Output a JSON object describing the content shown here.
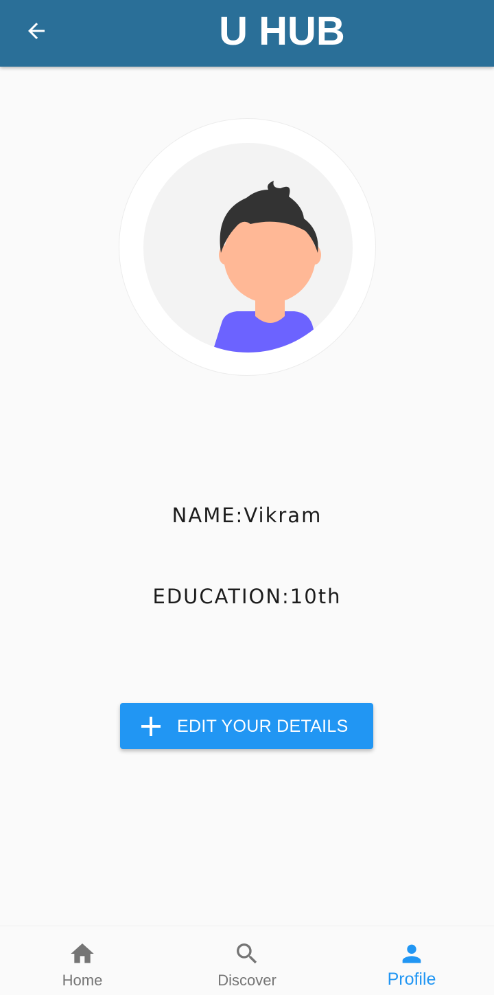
{
  "app_bar": {
    "title": "U HUB",
    "back_icon": "arrow-back-icon",
    "background_color": "#2a6f98"
  },
  "profile": {
    "avatar_icon": "avatar-illustration",
    "name_line": "NAME:Vikram",
    "education_line": "EDUCATION:10th"
  },
  "edit_button": {
    "label": "EDIT YOUR DETAILS",
    "icon": "plus-icon",
    "color": "#2196f3"
  },
  "bottom_nav": {
    "items": [
      {
        "label": "Home",
        "icon": "home-icon",
        "active": false
      },
      {
        "label": "Discover",
        "icon": "search-icon",
        "active": false
      },
      {
        "label": "Profile",
        "icon": "person-icon",
        "active": true
      }
    ],
    "active_color": "#2196f3",
    "inactive_color": "#757575"
  }
}
